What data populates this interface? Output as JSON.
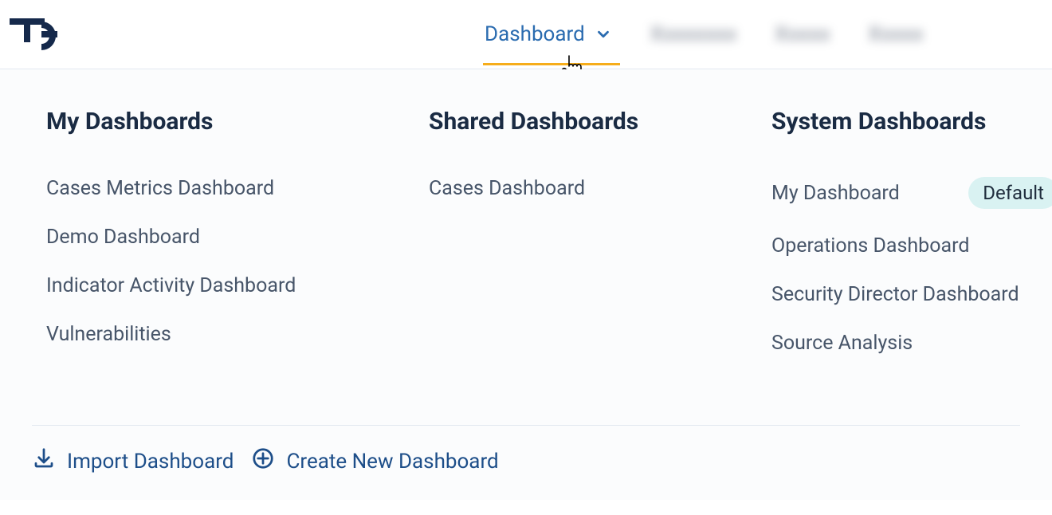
{
  "nav": {
    "active_label": "Dashboard",
    "blurred_items": [
      "Xxxxxxxx",
      "Xxxxx",
      "Xxxxx"
    ]
  },
  "dropdown": {
    "columns": {
      "my": {
        "title": "My Dashboards",
        "items": [
          {
            "label": "Cases Metrics Dashboard"
          },
          {
            "label": "Demo Dashboard"
          },
          {
            "label": "Indicator Activity Dashboard"
          },
          {
            "label": "Vulnerabilities"
          }
        ]
      },
      "shared": {
        "title": "Shared Dashboards",
        "items": [
          {
            "label": "Cases Dashboard"
          }
        ]
      },
      "system": {
        "title": "System Dashboards",
        "items": [
          {
            "label": "My Dashboard",
            "badge": "Default"
          },
          {
            "label": "Operations Dashboard"
          },
          {
            "label": "Security Director Dashboard"
          },
          {
            "label": "Source Analysis"
          }
        ]
      }
    },
    "footer": {
      "import_label": "Import Dashboard",
      "create_label": "Create New Dashboard"
    }
  }
}
